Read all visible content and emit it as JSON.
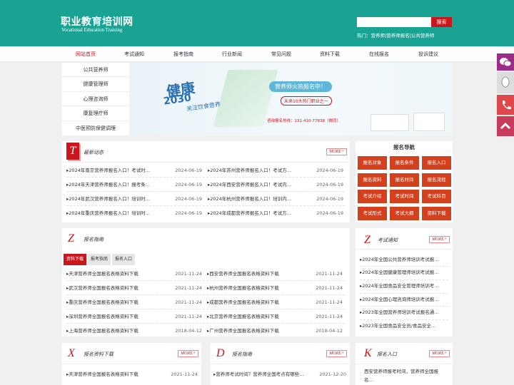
{
  "header": {
    "title": "职业教育培训网",
    "subtitle": "Vocational Education Training",
    "search_button": "搜索",
    "hot": "热门：营养师|营养师报名|公共营养师"
  },
  "nav": [
    "网站首页",
    "考试通知",
    "报考指南",
    "行业新闻",
    "常见问题",
    "资料下载",
    "在线报名",
    "投诉建议"
  ],
  "side_menu": [
    "公共营养师",
    "健康管理师",
    "心理咨询师",
    "康复理疗师",
    "中医预防保健调理"
  ],
  "banner": {
    "big": "健康",
    "year": "2030",
    "slogan": "关注饮食营养",
    "pill": "营养师火热报名中！",
    "sub": "未来10大热门职业之一",
    "phone": "咨询报名热线：131-410-77838（微同）"
  },
  "news": {
    "letter": "T",
    "title": "最新动态",
    "more": "MORE+",
    "left": [
      {
        "t": "▸2024年南京营养师报名入口！考试时…",
        "d": "2024-06-19"
      },
      {
        "t": "▸2024年天津营养师报名入口！报考条…",
        "d": "2024-06-19"
      },
      {
        "t": "▸2024年武汉营养师报名入口！培训时…",
        "d": "2024-06-19"
      },
      {
        "t": "▸2024年重庆营养师报名入口！培训时…",
        "d": "2024-06-19"
      }
    ],
    "right": [
      {
        "t": "▸2024年苏州营养师报名入口！考试方…",
        "d": "2024-06-19"
      },
      {
        "t": "▸2024年西安营养师报名入口！考试内…",
        "d": "2024-06-19"
      },
      {
        "t": "▸2024年杭州营养师报名入口！培训内…",
        "d": "2024-06-19"
      },
      {
        "t": "▸2024年成都营养师报名入口！考试方…",
        "d": "2024-06-19"
      }
    ]
  },
  "reg_nav": {
    "title": "报名导航",
    "buttons": [
      "报名对象",
      "报名条件",
      "报名入口",
      "报名资料",
      "报名时间",
      "报名流程",
      "考试介绍",
      "考试时间",
      "考试科目",
      "考试形式",
      "考试大纲",
      "资料下载"
    ]
  },
  "guide": {
    "letter": "Z",
    "title": "报名指南",
    "tabs": [
      "资料下载",
      "报考指南",
      "报名入口"
    ],
    "left": [
      {
        "t": "▸天津营养师全国报名表格资料下载",
        "d": "2021-11-24"
      },
      {
        "t": "▸武汉营养师全国报名表格资料下载",
        "d": "2021-11-24"
      },
      {
        "t": "▸重庆营养师全国报名表格资料下载",
        "d": "2021-11-24"
      },
      {
        "t": "▸深圳营养师全国报名表格资料下载",
        "d": "2021-11-24"
      },
      {
        "t": "▸上海营养师全国报名表格资料下载",
        "d": "2018-04-12"
      }
    ],
    "right": [
      {
        "t": "▸西安营养师全国报名表格资料下载",
        "d": "2021-11-24"
      },
      {
        "t": "▸杭州营养师全国报名表格资料下载",
        "d": "2021-11-24"
      },
      {
        "t": "▸成都营养师全国报名表格资料下载",
        "d": "2021-11-24"
      },
      {
        "t": "▸北京营养师全国报名表格资料下载",
        "d": "2021-11-24"
      },
      {
        "t": "▸广州营养师全国报名表格资料下载",
        "d": "2018-04-12"
      }
    ]
  },
  "exam": {
    "letter": "Z",
    "title": "考试通知",
    "more": "MORE+",
    "items": [
      "▸2024年全国公共营养师培训考试报…",
      "▸2024年全国健康管理师培训考试报…",
      "▸2024年全国食品安全管理师培训考…",
      "▸2024年全国心理咨询师培训考试报…",
      "▸2023年全国营养师培训考试报名通…",
      "▸2023年全国食品安全员/食品安全…"
    ]
  },
  "download": {
    "letter": "X",
    "title": "报名资料下载",
    "more": "MORE+",
    "item": {
      "t": "▸天津营养师全国报名表格资料下载",
      "d": "2021-11-24"
    }
  },
  "guide2": {
    "letter": "D",
    "title": "报名指南",
    "more": "MORE+",
    "item": {
      "t": "▸营养师考试时间？营养师全国考点有哪些…",
      "d": "2021-12-20"
    }
  },
  "entry": {
    "letter": "K",
    "title": "报名入口",
    "more": "MORE+",
    "text1": "西安营养师报考时间，营养师全国报",
    "text2": "名…"
  },
  "float_bar": {
    "colors": [
      "#9b2d86",
      "#dddddd",
      "#e0494b",
      "#c83b5a"
    ],
    "icons": [
      "wechat-icon",
      "qq-icon",
      "phone-icon",
      "top-icon"
    ]
  }
}
